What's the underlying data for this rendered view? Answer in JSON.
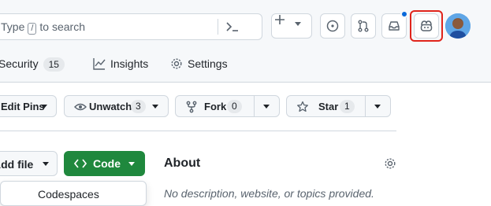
{
  "header": {
    "search_prefix": "Type",
    "search_key": "/",
    "search_suffix": "to search",
    "buttons": [
      "command-palette-icon",
      "plus-icon",
      "issue-icon",
      "pull-request-icon",
      "inbox-icon",
      "copilot-icon"
    ]
  },
  "tabs": [
    {
      "label": "Security",
      "count": "15",
      "icon": "shield-icon"
    },
    {
      "label": "Insights",
      "icon": "graph-icon"
    },
    {
      "label": "Settings",
      "icon": "gear-icon"
    }
  ],
  "actions": {
    "edit_pins": "Edit Pins",
    "unwatch": "Unwatch",
    "unwatch_count": "3",
    "fork": "Fork",
    "fork_count": "0",
    "star": "Star",
    "star_count": "1"
  },
  "files": {
    "add_file": "Add file",
    "code": "Code",
    "codespaces": "Codespaces"
  },
  "about": {
    "title": "About",
    "description": "No description, website, or topics provided."
  },
  "colors": {
    "accent_green": "#1f883d",
    "highlight_red": "#e0241b",
    "notification_blue": "#0969da"
  }
}
